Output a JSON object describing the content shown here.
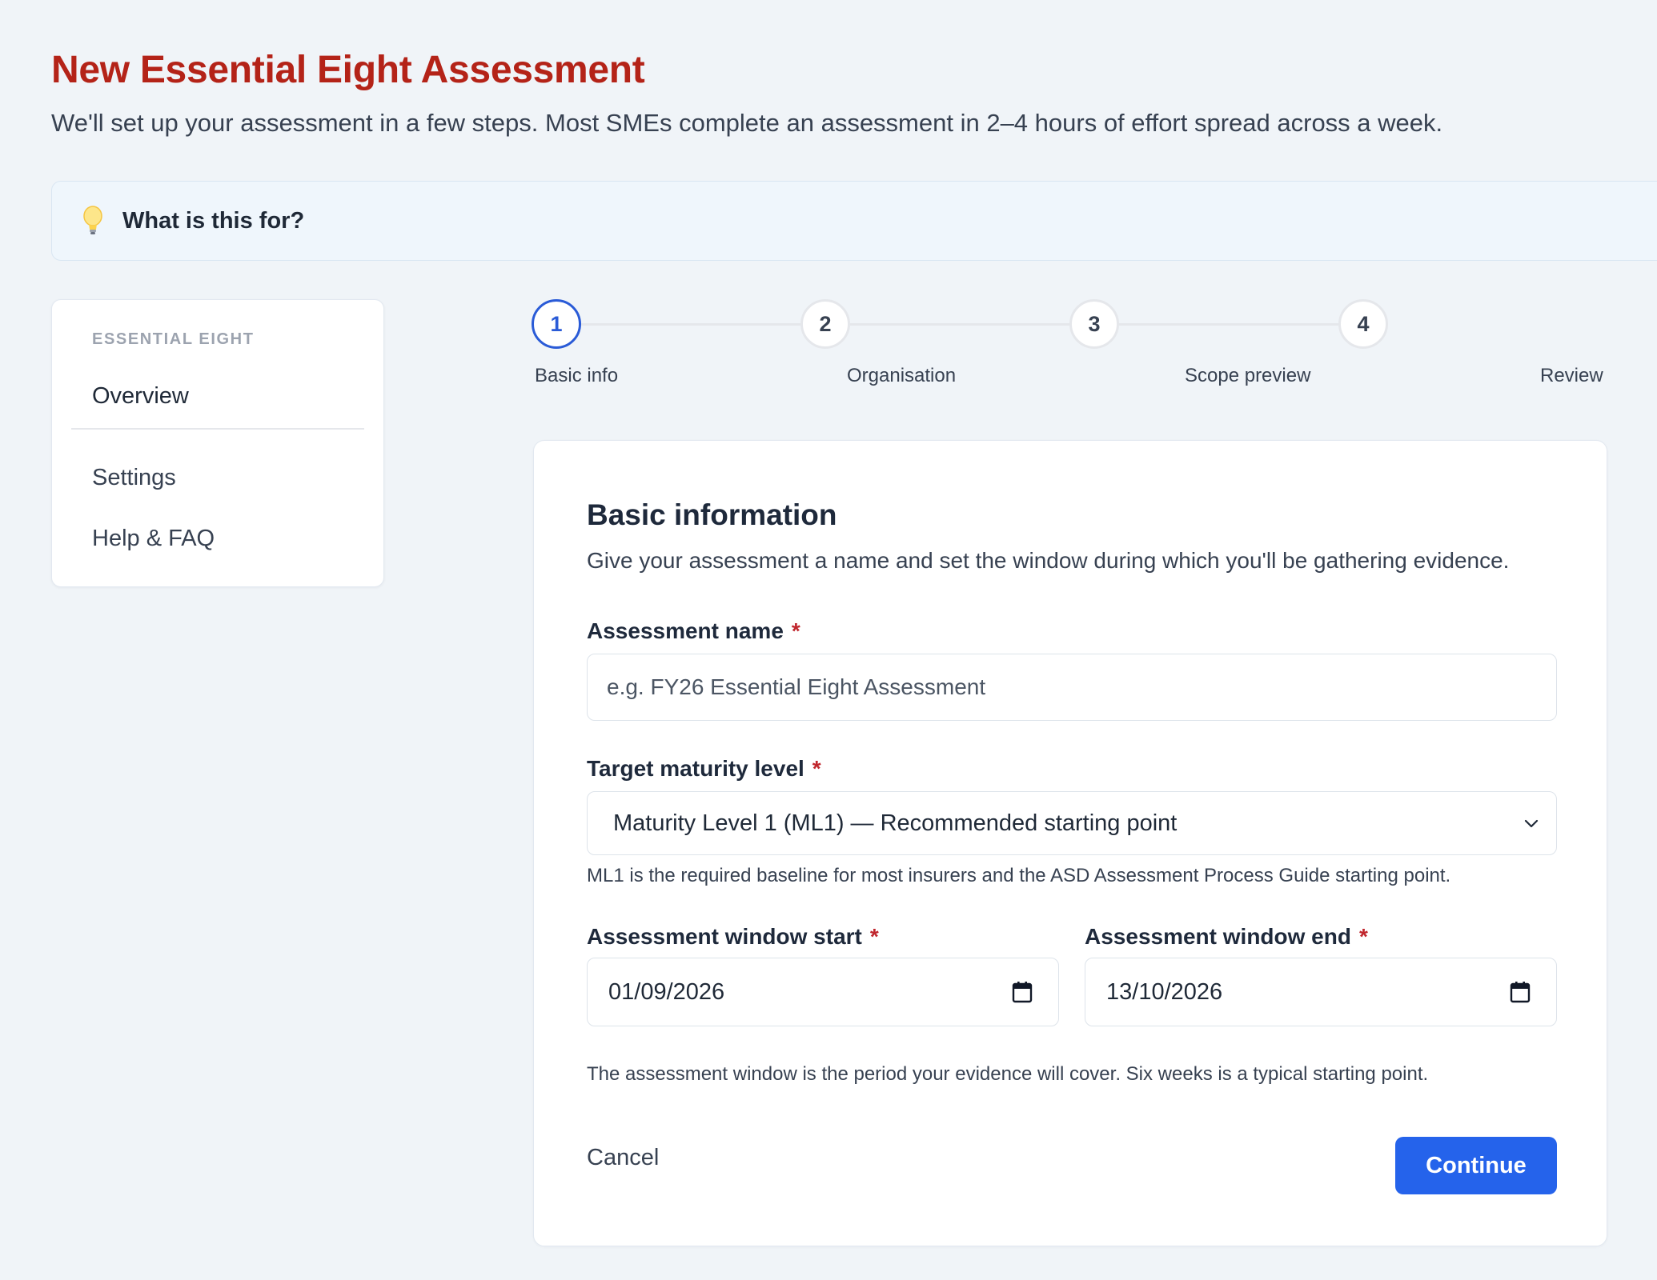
{
  "page": {
    "title": "New Essential Eight Assessment",
    "subtitle": "We'll set up your assessment in a few steps. Most SMEs complete an assessment in 2–4 hours of effort spread across a week."
  },
  "banner": {
    "icon": "lightbulb-icon",
    "text": "What is this for?"
  },
  "sidebar": {
    "section_label": "ESSENTIAL EIGHT",
    "items": [
      {
        "label": "Overview"
      },
      {
        "label": "Settings"
      },
      {
        "label": "Help & FAQ"
      }
    ]
  },
  "stepper": {
    "active_step": 1,
    "steps": [
      {
        "number": "1",
        "label": "Basic info"
      },
      {
        "number": "2",
        "label": "Organisation"
      },
      {
        "number": "3",
        "label": "Scope preview"
      },
      {
        "number": "4",
        "label": "Review"
      }
    ]
  },
  "form": {
    "title": "Basic information",
    "description": "Give your assessment a name and set the window during which you'll be gathering evidence.",
    "required_marker": "*",
    "name_label": "Assessment name",
    "name_value": "",
    "name_placeholder": "e.g. FY26 Essential Eight Assessment",
    "level_label": "Target maturity level",
    "level_value": "Maturity Level 1 (ML1) — Recommended starting point",
    "level_help": "ML1 is the required baseline for most insurers and the ASD Assessment Process Guide starting point.",
    "start_label": "Assessment window start",
    "start_value": "01/09/2026",
    "end_label": "Assessment window end",
    "end_value": "13/10/2026",
    "window_help": "The assessment window is the period your evidence will cover. Six weeks is a typical starting point.",
    "cancel_label": "Cancel",
    "continue_label": "Continue"
  },
  "colors": {
    "title_red": "#b42318",
    "primary_blue": "#2563eb",
    "active_step_blue": "#2a5bd7",
    "required_red": "#c0262d",
    "page_background": "#f0f4f8",
    "banner_background": "#eff6fc"
  }
}
